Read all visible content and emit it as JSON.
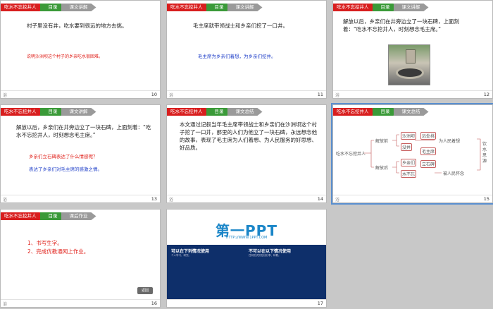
{
  "tabs": {
    "lesson": "吃水不忘挖井人",
    "catalog": "目录",
    "explain": "课文讲解",
    "summary": "课文总结",
    "homework": "课后作业"
  },
  "slides": [
    {
      "num": "10",
      "foot": "浴",
      "text": "村子里没有井，吃水要到很远的地方去挑。",
      "note": "说明沙洲坝这个村子的乡亲吃水很困难。"
    },
    {
      "num": "11",
      "foot": "浴",
      "text": "毛主席就带领战士和乡亲们挖了一口井。",
      "note": "毛主席为乡亲们着想，为乡亲们挖井。"
    },
    {
      "num": "12",
      "foot": "浴",
      "text": "解放以后，乡亲们在井旁边立了一块石碑，上面刻着：“吃水不忘挖井人，时刻想念毛主席。”"
    },
    {
      "num": "13",
      "foot": "浴",
      "text": "解放以后，乡亲们在井旁边立了一块石碑，上面刻着：“吃水不忘挖井人，时刻想念毛主席。”",
      "q": "乡亲们立石碑表达了什么情感呢？",
      "a": "表达了乡亲们对毛主席的感激之情。"
    },
    {
      "num": "14",
      "foot": "浴",
      "text": "本文通过记叙当年毛主席带领战士和乡亲们在沙洲坝这个村子挖了一口井，那里的人们为他立了一块石碑，永远想念他的故事，表现了毛主席为人们着想、为人民服务的好思想、好品质。"
    },
    {
      "num": "15",
      "foot": "浴",
      "diagram": {
        "root": "吃水不忘挖井人",
        "before": "解放前",
        "after": "解放后",
        "village": "沙洲坝",
        "far": "远处挑",
        "no_well": "没井",
        "chairman": "毛主席",
        "care": "为人民着想",
        "people": "乡亲们",
        "stone": "立石碑",
        "think": "被人民怀念",
        "water": "水不忘",
        "moral": "饮水思源"
      }
    },
    {
      "num": "16",
      "foot": "浴",
      "items": [
        "1、书写生字。",
        "2、完成优教通网上作业。"
      ],
      "back": "返回"
    },
    {
      "num": "17",
      "logo": "第一PPT",
      "url": "HTTP://WWW.1PPT.COM",
      "can_use": "可以在下列情况使用",
      "cannot_use": "不可以在以下情况使用",
      "can_sub": "个人学习、研究。",
      "cannot_sub": "任何形式的在线分享、转载。"
    }
  ]
}
